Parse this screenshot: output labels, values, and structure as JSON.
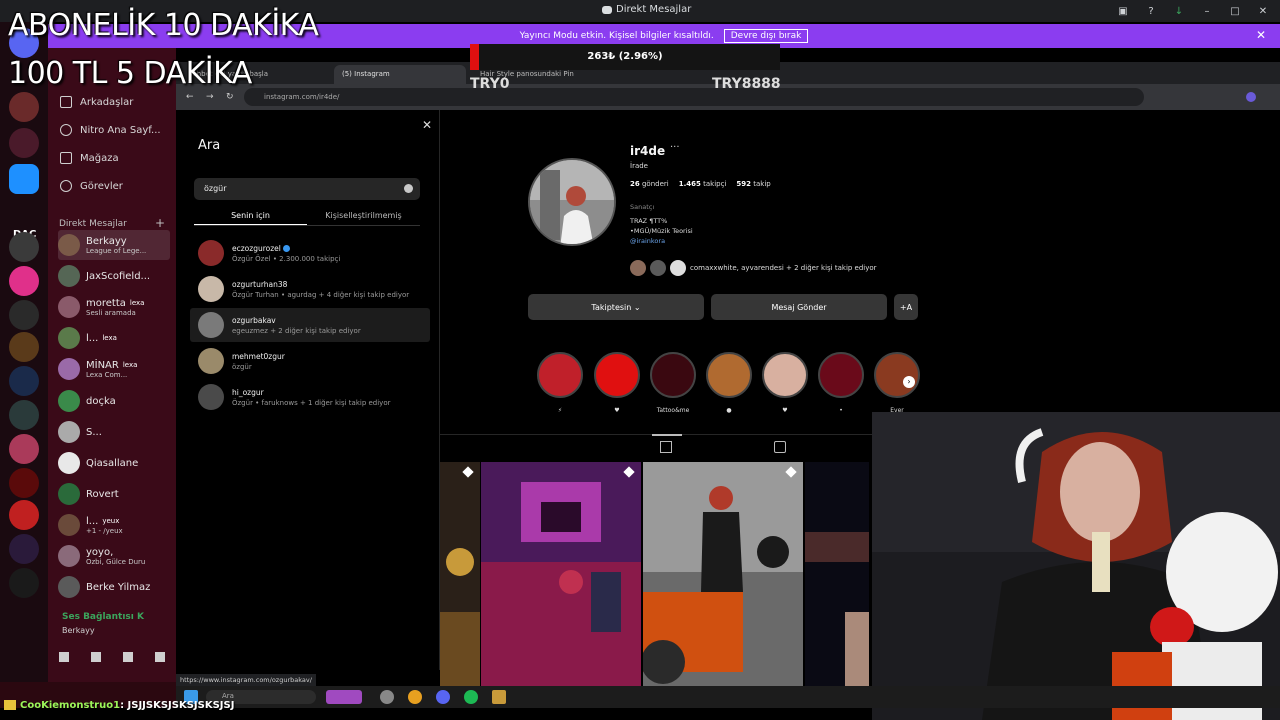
{
  "discord": {
    "window_title": "Direkt Mesajlar",
    "banner_text": "Yayıncı Modu etkin. Kişisel bilgiler kısaltıldı.",
    "banner_button": "Devre dışı bırak",
    "rail_label": "DAÇ",
    "nav": {
      "friends": "Arkadaşlar",
      "nitro": "Nitro Ana Sayf...",
      "shop": "Mağaza",
      "quests": "Görevler"
    },
    "dm_header": "Direkt Mesajlar",
    "dms": [
      {
        "name": "Berkayy",
        "sub": "League of Lege...",
        "color": "#7a5a48"
      },
      {
        "name": "JaxScofield...",
        "sub": "",
        "color": "#556655"
      },
      {
        "name": "moretta",
        "badge": "lexa",
        "sub": "Sesli aramada",
        "color": "#8a5a6a"
      },
      {
        "name": "l...",
        "badge": "lexa",
        "sub": "",
        "color": "#5a7a4a"
      },
      {
        "name": "MİNAR",
        "badge": "lexa",
        "sub": "Lexa Com...",
        "color": "#9a6aa8"
      },
      {
        "name": "doçka",
        "sub": "",
        "color": "#3a8a4a"
      },
      {
        "name": "S...",
        "sub": "",
        "color": "#aaaaaa"
      },
      {
        "name": "Qiasallane",
        "sub": "",
        "color": "#e8e8e8"
      },
      {
        "name": "Rovert",
        "sub": "",
        "color": "#2a6a3a"
      },
      {
        "name": "l...",
        "badge": "yeux",
        "sub": "+1 - /yeux",
        "color": "#6a4a3a"
      },
      {
        "name": "yoyo,",
        "sub": "Ozbi, Gülce Duru",
        "color": "#8a6a7a"
      },
      {
        "name": "Berke Yilmaz",
        "sub": "",
        "color": "#5a5a5a"
      }
    ],
    "voice_status": "Ses Bağlantısı K",
    "voice_user": "Berkayy"
  },
  "overlay": {
    "line1": "ABONELİK 10 DAKİKA",
    "line2": "100 TL 5 DAKİKA",
    "donation_amount": "263₺ (2.96%)",
    "donation_progress_pct": 2.96,
    "donation_left": "TRY0",
    "donation_right": "TRY8888",
    "chat_user": "CooKiemonstruo1",
    "chat_text": ": JSJJSKSJSKSJSKSJSJ"
  },
  "browser": {
    "tabs": [
      {
        "label": "Sohbet edl ya da başla",
        "active": false
      },
      {
        "label": "(5) Instagram",
        "active": true
      },
      {
        "label": "Hair Style panosundaki Pin",
        "active": false
      }
    ],
    "url": "instagram.com/ir4de/",
    "status_url": "https://www.instagram.com/ozgurbakav/"
  },
  "search": {
    "title": "Ara",
    "query": "özgür",
    "tab_for_you": "Senin için",
    "tab_unpersonalized": "Kişiselleştirilmemiş",
    "results": [
      {
        "handle": "eczozgurozel",
        "sub": "Özgür Özel • 2.300.000 takipçi",
        "verified": true,
        "color": "#8a2a2a"
      },
      {
        "handle": "ozgurturhan38",
        "sub": "Özgür Turhan • agurdag + 4 diğer kişi takip ediyor",
        "verified": false,
        "color": "#c8b8a8"
      },
      {
        "handle": "ozgurbakav",
        "sub": "egeuzmez + 2 diğer kişi takip ediyor",
        "verified": false,
        "color": "#7a7a7a"
      },
      {
        "handle": "mehmet0zgur",
        "sub": "özgür",
        "verified": false,
        "color": "#9a8a6a"
      },
      {
        "handle": "hi_ozgur",
        "sub": "Özgür • faruknows + 1 diğer kişi takip ediyor",
        "verified": false,
        "color": "#4a4a4a"
      }
    ]
  },
  "profile": {
    "username": "ir4de",
    "full_name": "İrade",
    "posts": "26",
    "posts_label": "gönderi",
    "followers": "1.465",
    "followers_label": "takipçi",
    "following": "592",
    "following_label": "takip",
    "category": "Sanatçı",
    "bio_lines": [
      "TRAZ ¶TT%",
      "•MGÜ/Müzik Teorisi"
    ],
    "bio_link": "@irainkora",
    "mutual_text": "comaxxwhite, ayvarendesi + 2 diğer kişi takip ediyor",
    "btn_following": "Takiptesin ⌄",
    "btn_message": "Mesaj Gönder",
    "btn_add": "+A"
  },
  "highlights": [
    {
      "label": "⚡",
      "color": "#c0202a"
    },
    {
      "label": "♥",
      "color": "#e01010"
    },
    {
      "label": "Tattoo&me",
      "color": "#3a0810"
    },
    {
      "label": "●",
      "color": "#b06a30"
    },
    {
      "label": "♥",
      "color": "#d8b0a0"
    },
    {
      "label": "•",
      "color": "#6a0a1a"
    },
    {
      "label": "Ever",
      "color": "#8a3a20"
    }
  ],
  "taskbar": {
    "search_placeholder": "Ara"
  }
}
